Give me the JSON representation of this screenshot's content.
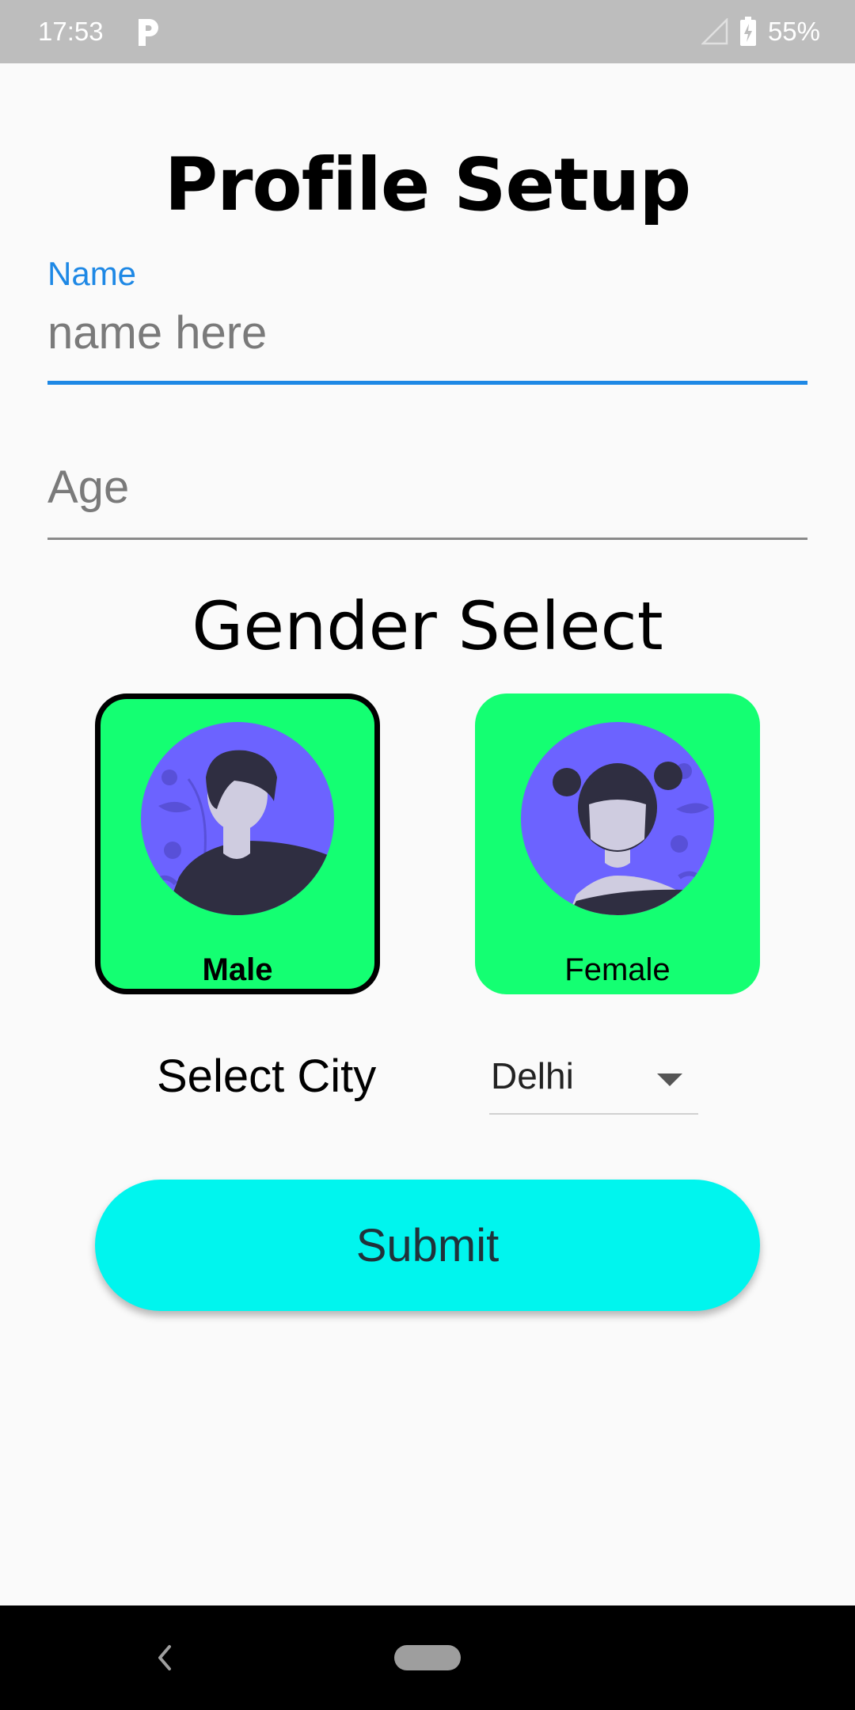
{
  "status_bar": {
    "time": "17:53",
    "battery": "55%",
    "app_icon": "parking-p-icon"
  },
  "title": "Profile Setup",
  "name_field": {
    "label": "Name",
    "placeholder": "name here",
    "value": ""
  },
  "age_field": {
    "placeholder": "Age",
    "value": ""
  },
  "gender": {
    "heading": "Gender Select",
    "selected": "Male",
    "options": [
      {
        "label": "Male",
        "icon": "male-avatar-icon"
      },
      {
        "label": "Female",
        "icon": "female-avatar-icon"
      }
    ]
  },
  "city": {
    "label": "Select City",
    "selected": "Delhi"
  },
  "submit": {
    "label": "Submit"
  },
  "colors": {
    "accent_blue": "#1e88e5",
    "card_green": "#14ff72",
    "avatar_purple": "#6c63ff",
    "submit_cyan": "#00f5ee",
    "status_bar_gray": "#bdbdbd"
  }
}
